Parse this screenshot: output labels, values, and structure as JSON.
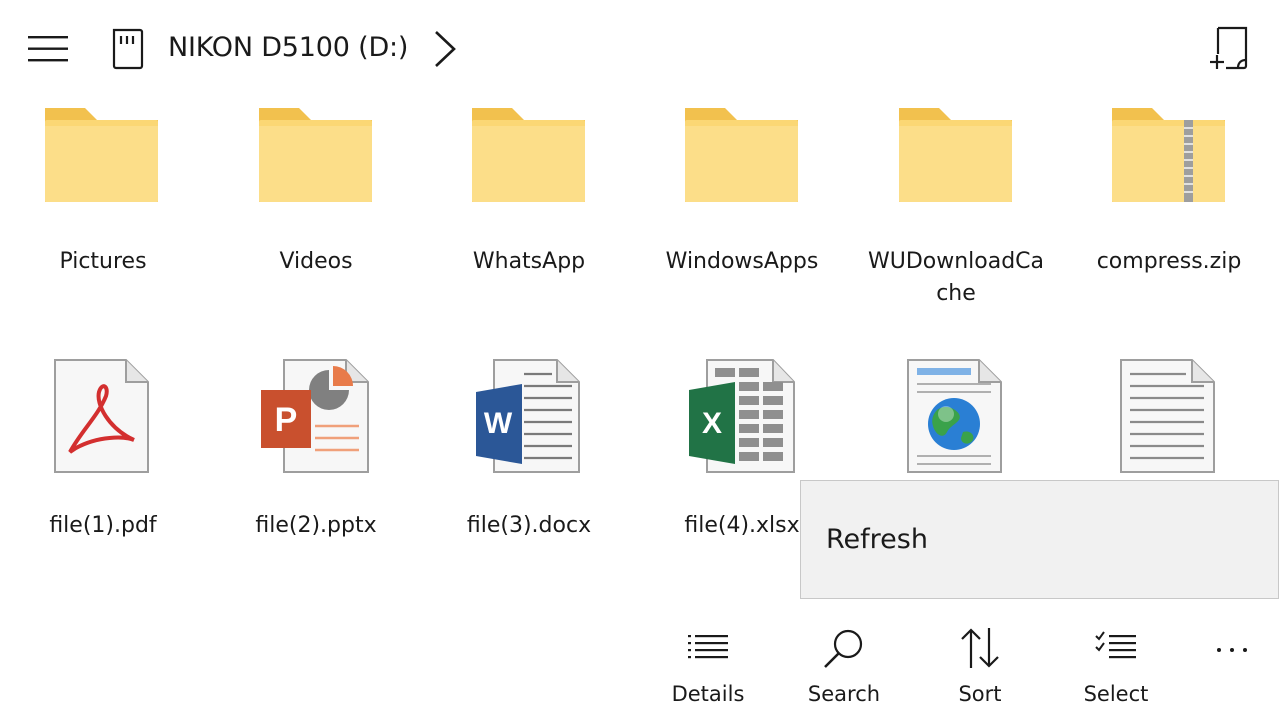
{
  "header": {
    "title": "NIKON D5100 (D:)",
    "icons": {
      "menu": "hamburger-icon",
      "drive": "sd-card-icon",
      "forward": "chevron-right-icon",
      "new_file": "new-file-icon"
    }
  },
  "items": [
    {
      "name": "Pictures",
      "type": "folder"
    },
    {
      "name": "Videos",
      "type": "folder"
    },
    {
      "name": "WhatsApp",
      "type": "folder"
    },
    {
      "name": "WindowsApps",
      "type": "folder"
    },
    {
      "name": "WUDownloadCache",
      "type": "folder"
    },
    {
      "name": "compress.zip",
      "type": "zip"
    },
    {
      "name": "file(1).pdf",
      "type": "pdf"
    },
    {
      "name": "file(2).pptx",
      "type": "pptx"
    },
    {
      "name": "file(3).docx",
      "type": "docx"
    },
    {
      "name": "file(4).xlsx",
      "type": "xlsx"
    },
    {
      "name": "",
      "type": "html"
    },
    {
      "name": "",
      "type": "txt"
    }
  ],
  "context_menu": {
    "refresh_label": "Refresh"
  },
  "command_bar": {
    "details_label": "Details",
    "search_label": "Search",
    "sort_label": "Sort",
    "select_label": "Select",
    "more_label": "···"
  },
  "colors": {
    "folder": "#fbd774",
    "folder_light": "#fde9a8",
    "pdf": "#d32f2f",
    "pptx": "#c9502e",
    "docx": "#2b5797",
    "xlsx": "#217346",
    "menu_bg": "#f1f1f1"
  }
}
